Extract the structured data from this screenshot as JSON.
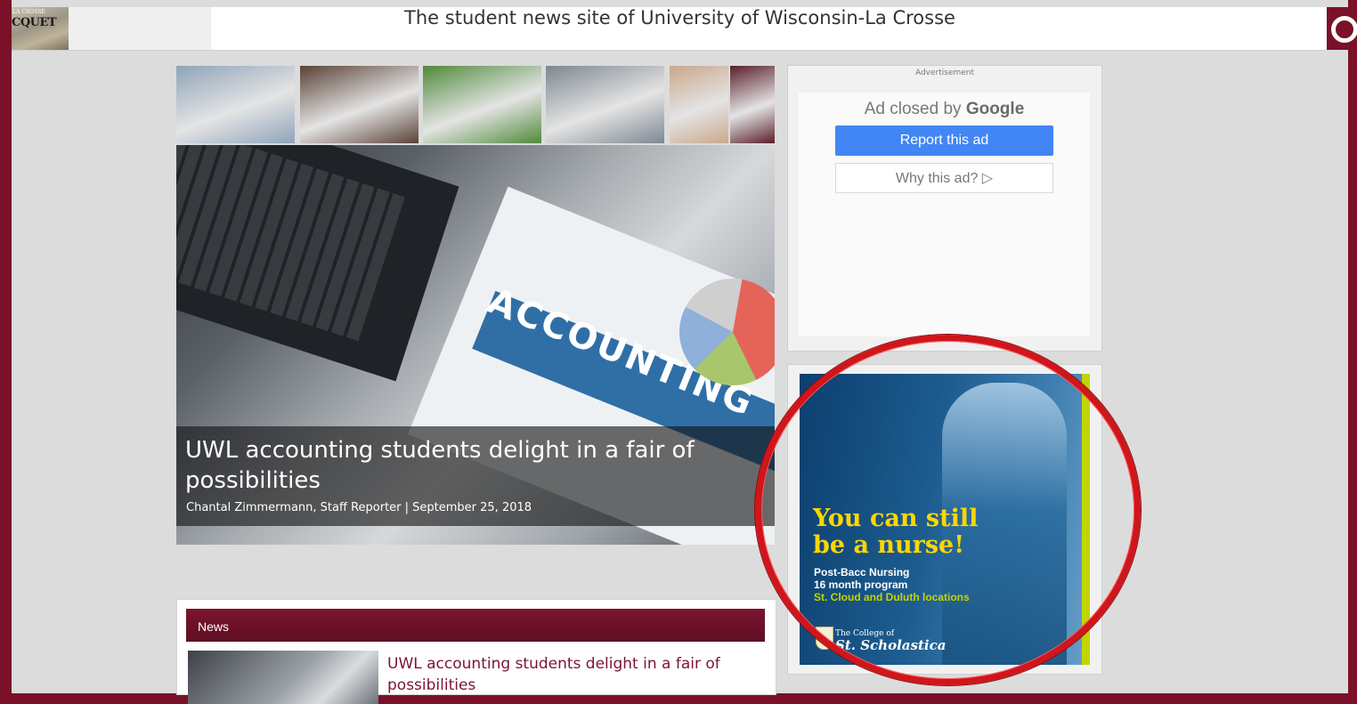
{
  "header": {
    "logo_small": "LA CROSSE",
    "logo_word": "CQUET",
    "tagline": "The student news site of University of Wisconsin-La Crosse",
    "search_icon": "search-icon"
  },
  "featured_strip": [
    {
      "name": "accounting-thumb",
      "color": "#8ea4b9"
    },
    {
      "name": "students-thumb",
      "color": "#5a4236"
    },
    {
      "name": "golf-thumb",
      "color": "#4f8a3a"
    },
    {
      "name": "group-thumb",
      "color": "#7d8791"
    },
    {
      "name": "portrait-thumb",
      "color": "#c9a88a"
    },
    {
      "name": "actress-thumb",
      "color": "#5a1f2a"
    }
  ],
  "hero": {
    "image_text": "ACCOUNTING",
    "title": "UWL accounting students delight in a fair of possibilities",
    "byline": "Chantal Zimmermann, Staff Reporter | September 25, 2018"
  },
  "ad1": {
    "label": "Advertisement",
    "closed_prefix": "Ad closed by",
    "closed_brand": "Google",
    "report_label": "Report this ad",
    "why_label": "Why this ad? ▷"
  },
  "ad2": {
    "headline_1": "You can still",
    "headline_2": "be a nurse!",
    "line_1": "Post-Bacc Nursing",
    "line_2": "16 month program",
    "line_3": "St. Cloud and Duluth locations",
    "college_of": "The College of",
    "college_name": "St. Scholastica"
  },
  "news": {
    "header": "News",
    "items": [
      {
        "title": "UWL accounting students delight in a fair of possibilities"
      }
    ]
  },
  "colors": {
    "brand": "#7a1128",
    "highlight_circle": "#d0151b",
    "ad_button": "#4285f4"
  }
}
